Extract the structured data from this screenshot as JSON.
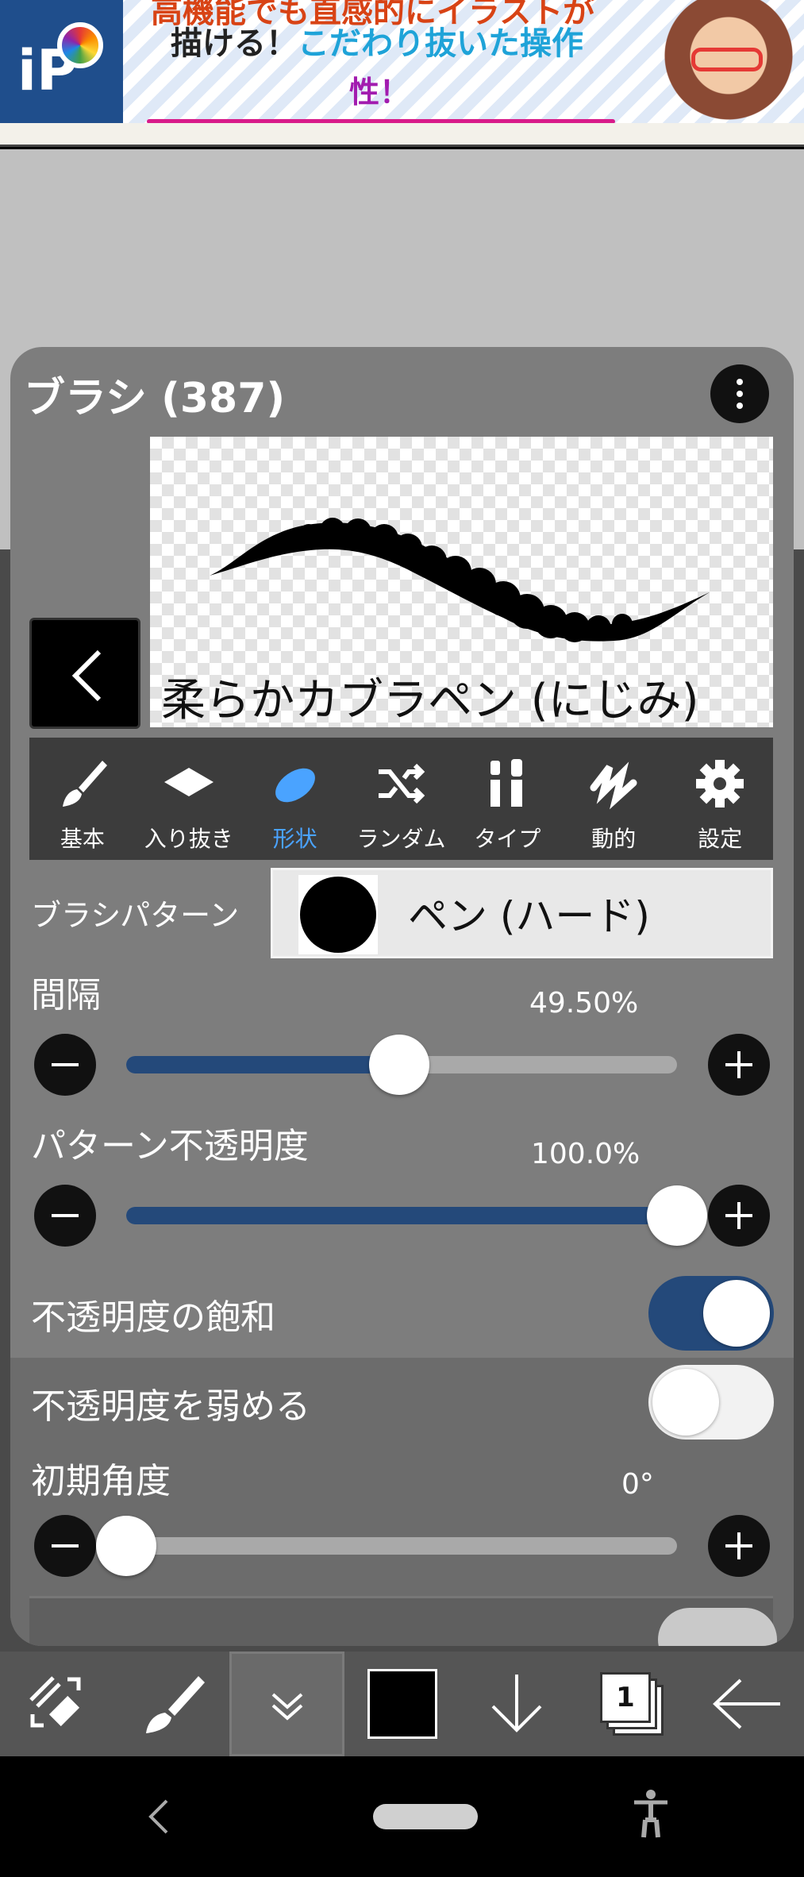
{
  "ad": {
    "line1": "高機能でも直感的にイラストが",
    "line2_start": "描ける！",
    "line2_highlight": "こだわり抜いた操作",
    "line3": "性！",
    "logo_text": "iP"
  },
  "panel": {
    "title": "ブラシ (387)",
    "brush_name": "柔らかカブラペン (にじみ)",
    "tabs": [
      {
        "label": "基本",
        "icon": "brush-icon"
      },
      {
        "label": "入り抜き",
        "icon": "diamond-icon"
      },
      {
        "label": "形状",
        "icon": "oval-icon",
        "active": true
      },
      {
        "label": "ランダム",
        "icon": "shuffle-icon"
      },
      {
        "label": "タイプ",
        "icon": "type-icon"
      },
      {
        "label": "動的",
        "icon": "dynamic-icon"
      },
      {
        "label": "設定",
        "icon": "gear-icon"
      }
    ],
    "brush_pattern": {
      "label": "ブラシパターン",
      "value": "ペン (ハード)"
    },
    "spacing": {
      "label": "間隔",
      "value_text": "49.50%",
      "value": 0.495
    },
    "pattern_opacity": {
      "label": "パターン不透明度",
      "value_text": "100.0%",
      "value": 1.0
    },
    "opacity_saturation": {
      "label": "不透明度の飽和",
      "on": true
    },
    "opacity_weaken": {
      "label": "不透明度を弱める",
      "on": false
    },
    "initial_angle": {
      "label": "初期角度",
      "value_text": "0°",
      "value": 0
    }
  },
  "toolbar": {
    "layer_count": "1",
    "color": "#000000"
  },
  "colors": {
    "accent": "#24497a",
    "active_tab": "#4aa3ff"
  }
}
